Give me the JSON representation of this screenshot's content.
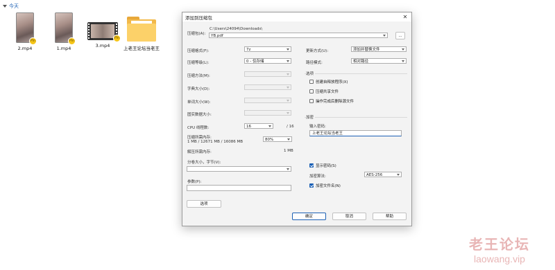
{
  "explorer": {
    "group_label": "今天",
    "files": [
      {
        "name": "2.mp4",
        "icon": "video-thumbnail"
      },
      {
        "name": "1.mp4",
        "icon": "video-thumbnail"
      },
      {
        "name": "3.mp4",
        "icon": "video-film-thumbnail"
      },
      {
        "name": "上老王论坛当老王",
        "icon": "folder"
      }
    ],
    "badge_text": "Pin"
  },
  "dialog": {
    "title": "添加到压缩包",
    "archive_label": "压缩包(A):",
    "archive_dir": "C:\\Users\\24094\\Downloads\\",
    "archive_name": "YB.pdf",
    "browse_label": "...",
    "left": {
      "format_label": "压缩格式(F):",
      "format_value": "7z",
      "level_label": "压缩等级(L):",
      "level_value": "0 - 仅存储",
      "method_label": "压缩方法(M):",
      "dict_label": "字典大小(D):",
      "word_label": "单词大小(W):",
      "solid_label": "固实数据大小:",
      "cpu_label": "CPU 线程数:",
      "cpu_value": "16",
      "cpu_total": "/ 16",
      "mem_label": "压缩所需内存:",
      "mem_detail": "1 MB / 12671 MB / 16086 MB",
      "mem_percent": "80%",
      "decomp_label": "解压所需内存:",
      "decomp_value": "1 MB",
      "split_label": "分卷大小，字节(V):",
      "params_label": "参数(P):",
      "options_button": "选项"
    },
    "right": {
      "update_label": "更新方式(U):",
      "update_value": "添加并替换文件",
      "path_label": "路径模式:",
      "path_value": "相对路径",
      "options_title": "选项",
      "opt_sfx": "创建自释放程序(X)",
      "opt_shared": "压缩共享文件",
      "opt_delete": "操作完成后删除源文件",
      "enc_title": "加密",
      "password_label": "输入密码:",
      "password_value": "上老王论坛当老王",
      "show_password": "显示密码(S)",
      "enc_method_label": "加密算法:",
      "enc_method_value": "AES-256",
      "encrypt_names": "加密文件名(N)"
    },
    "buttons": {
      "ok": "确定",
      "cancel": "取消",
      "help": "帮助"
    }
  },
  "watermark": {
    "cn": "老王论坛",
    "en": "laowang.vip"
  },
  "colors": {
    "accent": "#1a5fb4",
    "folder": "#fcd169",
    "watermark": "#d77a7a"
  }
}
